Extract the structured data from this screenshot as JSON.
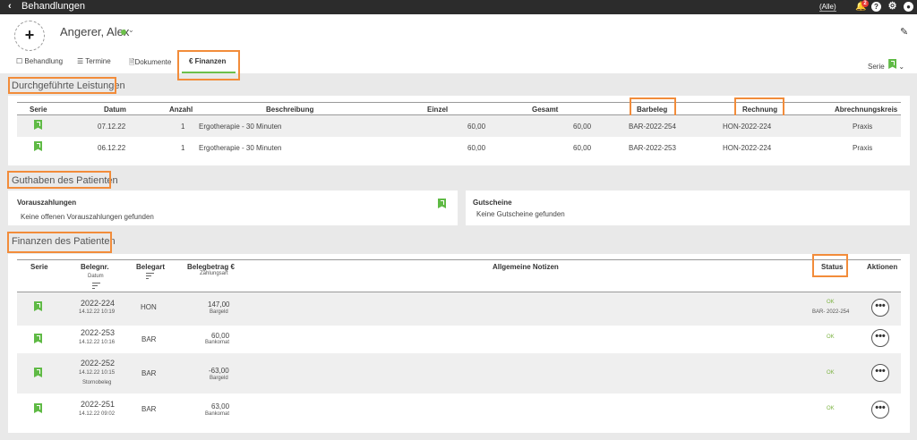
{
  "topbar": {
    "title": "Behandlungen",
    "filter": "(Alle)",
    "notif_count": "2",
    "help": "?"
  },
  "patient": {
    "name": "Angerer, Alex"
  },
  "tabs": [
    {
      "label": "Behandlung"
    },
    {
      "label": "Termine"
    },
    {
      "label": "Dokumente"
    },
    {
      "label": "€ Finanzen"
    }
  ],
  "serie_label": "Serie",
  "leistungen": {
    "title": "Durchgeführte Leistungen",
    "headers": {
      "serie": "Serie",
      "datum": "Datum",
      "anzahl": "Anzahl",
      "beschreibung": "Beschreibung",
      "einzel": "Einzel",
      "gesamt": "Gesamt",
      "barbeleg": "Barbeleg",
      "rechnung": "Rechnung",
      "kreis": "Abrechnungskreis"
    },
    "rows": [
      {
        "datum": "07.12.22",
        "anzahl": "1",
        "beschreibung": "Ergotherapie - 30 Minuten",
        "einzel": "60,00",
        "gesamt": "60,00",
        "barbeleg": "BAR-2022-254",
        "rechnung": "HON-2022-224",
        "kreis": "Praxis"
      },
      {
        "datum": "06.12.22",
        "anzahl": "1",
        "beschreibung": "Ergotherapie - 30 Minuten",
        "einzel": "60,00",
        "gesamt": "60,00",
        "barbeleg": "BAR-2022-253",
        "rechnung": "HON-2022-224",
        "kreis": "Praxis"
      }
    ]
  },
  "guthaben": {
    "title": "Guthaben des Patienten",
    "voraus_title": "Vorauszahlungen",
    "voraus_empty": "Keine offenen Vorauszahlungen gefunden",
    "gutscheine_title": "Gutscheine",
    "gutscheine_empty": "Keine Gutscheine gefunden"
  },
  "finanzen": {
    "title": "Finanzen des Patienten",
    "headers": {
      "serie": "Serie",
      "belegnr": "Belegnr.",
      "datum": "Datum",
      "belegart": "Belegart",
      "betrag": "Belegbetrag €",
      "zahlungsart": "Zahlungsart",
      "notizen": "Allgemeine Notizen",
      "status": "Status",
      "aktionen": "Aktionen"
    },
    "rows": [
      {
        "nr": "2022-224",
        "datum": "14.12.22 10:19",
        "note": "",
        "art": "HON",
        "betrag": "147,00",
        "zahlungsart": "Bargeld",
        "status": "OK",
        "status_sub": "BAR- 2022-254"
      },
      {
        "nr": "2022-253",
        "datum": "14.12.22 10:16",
        "note": "",
        "art": "BAR",
        "betrag": "60,00",
        "zahlungsart": "Bankomat",
        "status": "OK",
        "status_sub": ""
      },
      {
        "nr": "2022-252",
        "datum": "14.12.22 10:15",
        "note": "Stornobeleg",
        "art": "BAR",
        "betrag": "-63,00",
        "zahlungsart": "Bargeld",
        "status": "OK",
        "status_sub": ""
      },
      {
        "nr": "2022-251",
        "datum": "14.12.22 09:02",
        "note": "",
        "art": "BAR",
        "betrag": "63,00",
        "zahlungsart": "Bankomat",
        "status": "OK",
        "status_sub": ""
      }
    ],
    "more_label": "•••"
  },
  "colors": {
    "accent_green": "#6cc04a",
    "highlight_orange": "#f28c3a",
    "topbar": "#2c2c2c"
  }
}
